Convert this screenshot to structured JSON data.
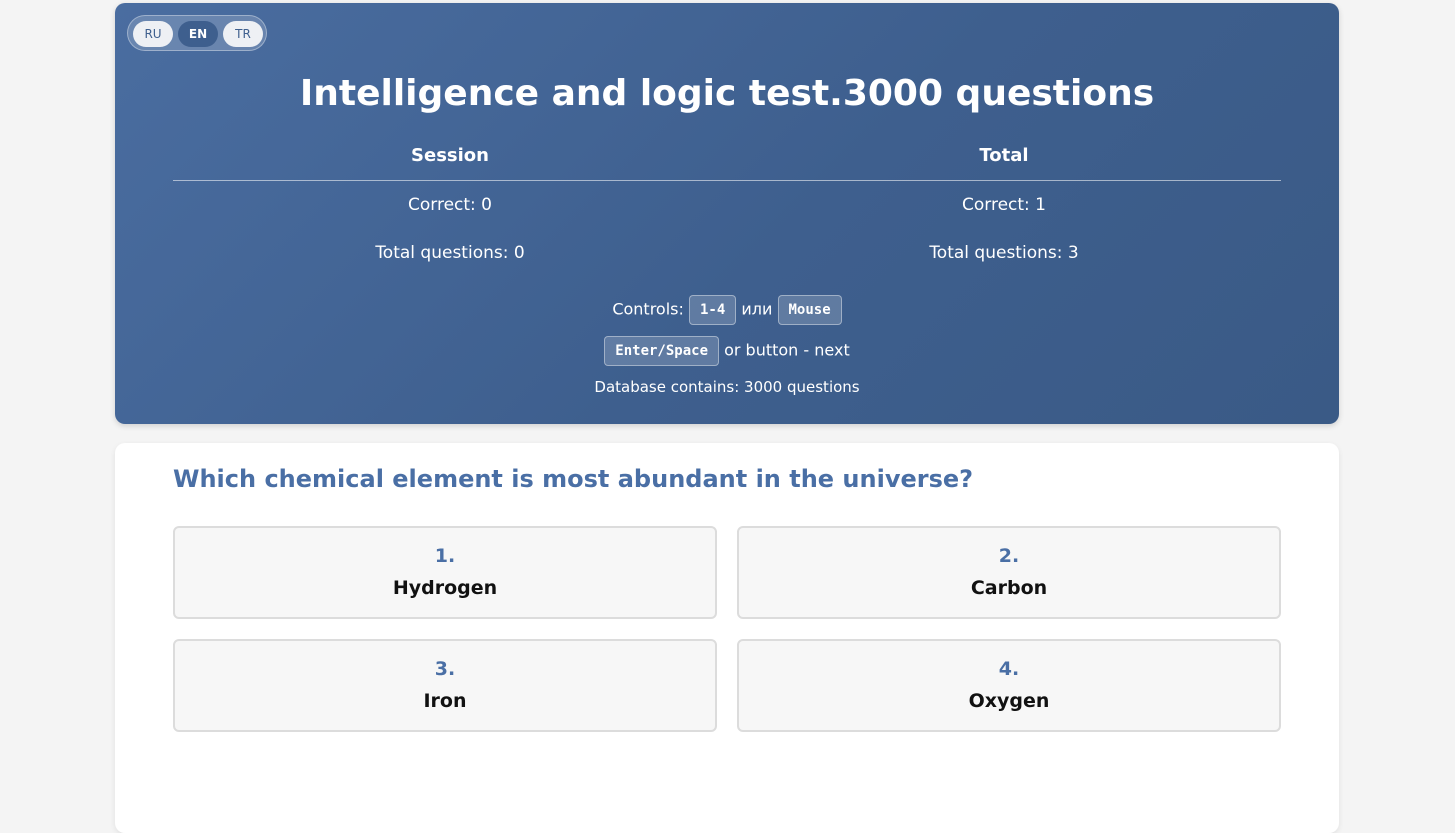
{
  "languages": [
    {
      "code": "RU",
      "active": false
    },
    {
      "code": "EN",
      "active": true
    },
    {
      "code": "TR",
      "active": false
    }
  ],
  "header": {
    "title": "Intelligence and logic test.3000 questions"
  },
  "stats": {
    "session_label": "Session",
    "total_label": "Total",
    "session_correct": "Correct: 0",
    "session_total": "Total questions: 0",
    "total_correct": "Correct: 1",
    "total_total": "Total questions: 3"
  },
  "controls": {
    "prefix": "Controls:",
    "key_numbers": "1-4",
    "or_word": "или",
    "key_mouse": "Mouse",
    "key_next": "Enter/Space",
    "next_text": "or button - next",
    "database_text": "Database contains: 3000 questions"
  },
  "question": {
    "text": "Which chemical element is most abundant in the universe?",
    "answers": [
      {
        "num": "1.",
        "text": "Hydrogen"
      },
      {
        "num": "2.",
        "text": "Carbon"
      },
      {
        "num": "3.",
        "text": "Iron"
      },
      {
        "num": "4.",
        "text": "Oxygen"
      }
    ]
  },
  "colors": {
    "header_bg": "#3e5f8e",
    "accent": "#4a6fa5",
    "page_bg": "#f4f4f4"
  }
}
